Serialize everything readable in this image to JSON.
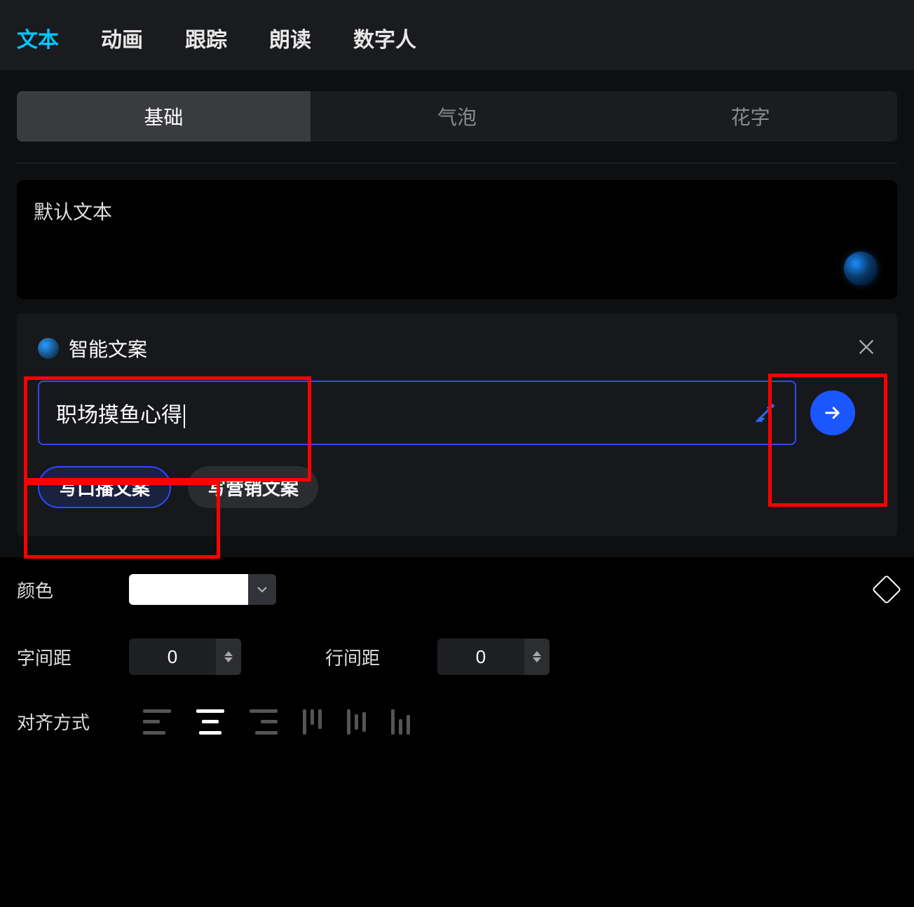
{
  "top_tabs": {
    "items": [
      "文本",
      "动画",
      "跟踪",
      "朗读",
      "数字人"
    ],
    "active_index": 0
  },
  "sub_tabs": {
    "items": [
      "基础",
      "气泡",
      "花字"
    ],
    "active_index": 0
  },
  "text_box": {
    "content": "默认文本"
  },
  "ai_popup": {
    "title": "智能文案",
    "input_value": "职场摸鱼心得",
    "chips": [
      "写口播文案",
      "写营销文案"
    ],
    "active_chip_index": 0
  },
  "color_row": {
    "label": "颜色",
    "value": "#FFFFFF"
  },
  "spacing": {
    "letter_label": "字间距",
    "letter_value": "0",
    "line_label": "行间距",
    "line_value": "0"
  },
  "alignment": {
    "label": "对齐方式",
    "active_index": 1
  }
}
